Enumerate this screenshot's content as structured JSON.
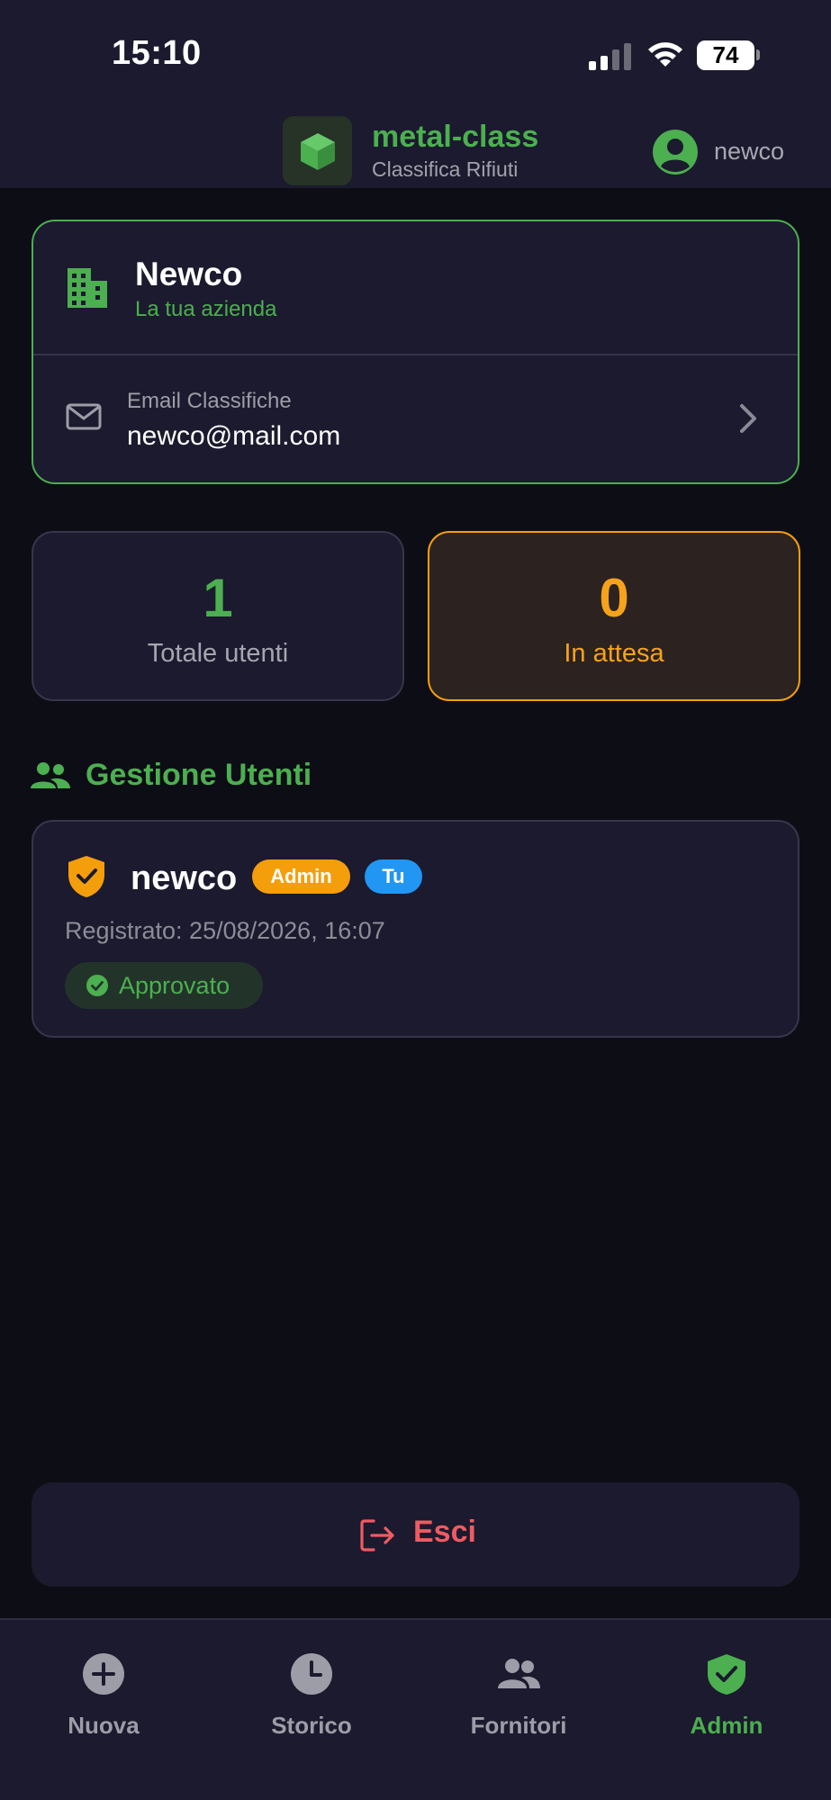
{
  "status_bar": {
    "time": "15:10",
    "battery": "74",
    "icons": [
      "cellular-signal-icon",
      "wifi-icon",
      "battery-icon"
    ]
  },
  "header": {
    "app_title": "metal-class",
    "app_subtitle": "Classifica Rifiuti",
    "username": "newco",
    "logo_icon": "cube-icon",
    "avatar_icon": "account-circle-icon"
  },
  "company": {
    "name": "Newco",
    "subtitle": "La tua azienda",
    "email_label": "Email Classifiche",
    "email": "newco@mail.com"
  },
  "stats": {
    "total_value": "1",
    "total_label": "Totale utenti",
    "pending_value": "0",
    "pending_label": "In attesa"
  },
  "users_section": {
    "title": "Gestione Utenti",
    "users": [
      {
        "name": "newco",
        "role_badge": "Admin",
        "self_badge": "Tu",
        "registered": "Registrato: 25/08/2026, 16:07",
        "status": "Approvato"
      }
    ]
  },
  "logout": {
    "label": "Esci"
  },
  "bottom_nav": {
    "items": [
      {
        "label": "Nuova",
        "icon": "plus-circle-icon"
      },
      {
        "label": "Storico",
        "icon": "clock-icon"
      },
      {
        "label": "Fornitori",
        "icon": "people-icon"
      },
      {
        "label": "Admin",
        "icon": "shield-check-icon",
        "active": true
      }
    ]
  },
  "colors": {
    "accent_green": "#4caf50",
    "pending_orange": "#f59e0b",
    "self_blue": "#2196f3",
    "logout_red": "#ef5b62",
    "card_bg": "#1b1a2e",
    "page_bg": "#0d0d16"
  }
}
